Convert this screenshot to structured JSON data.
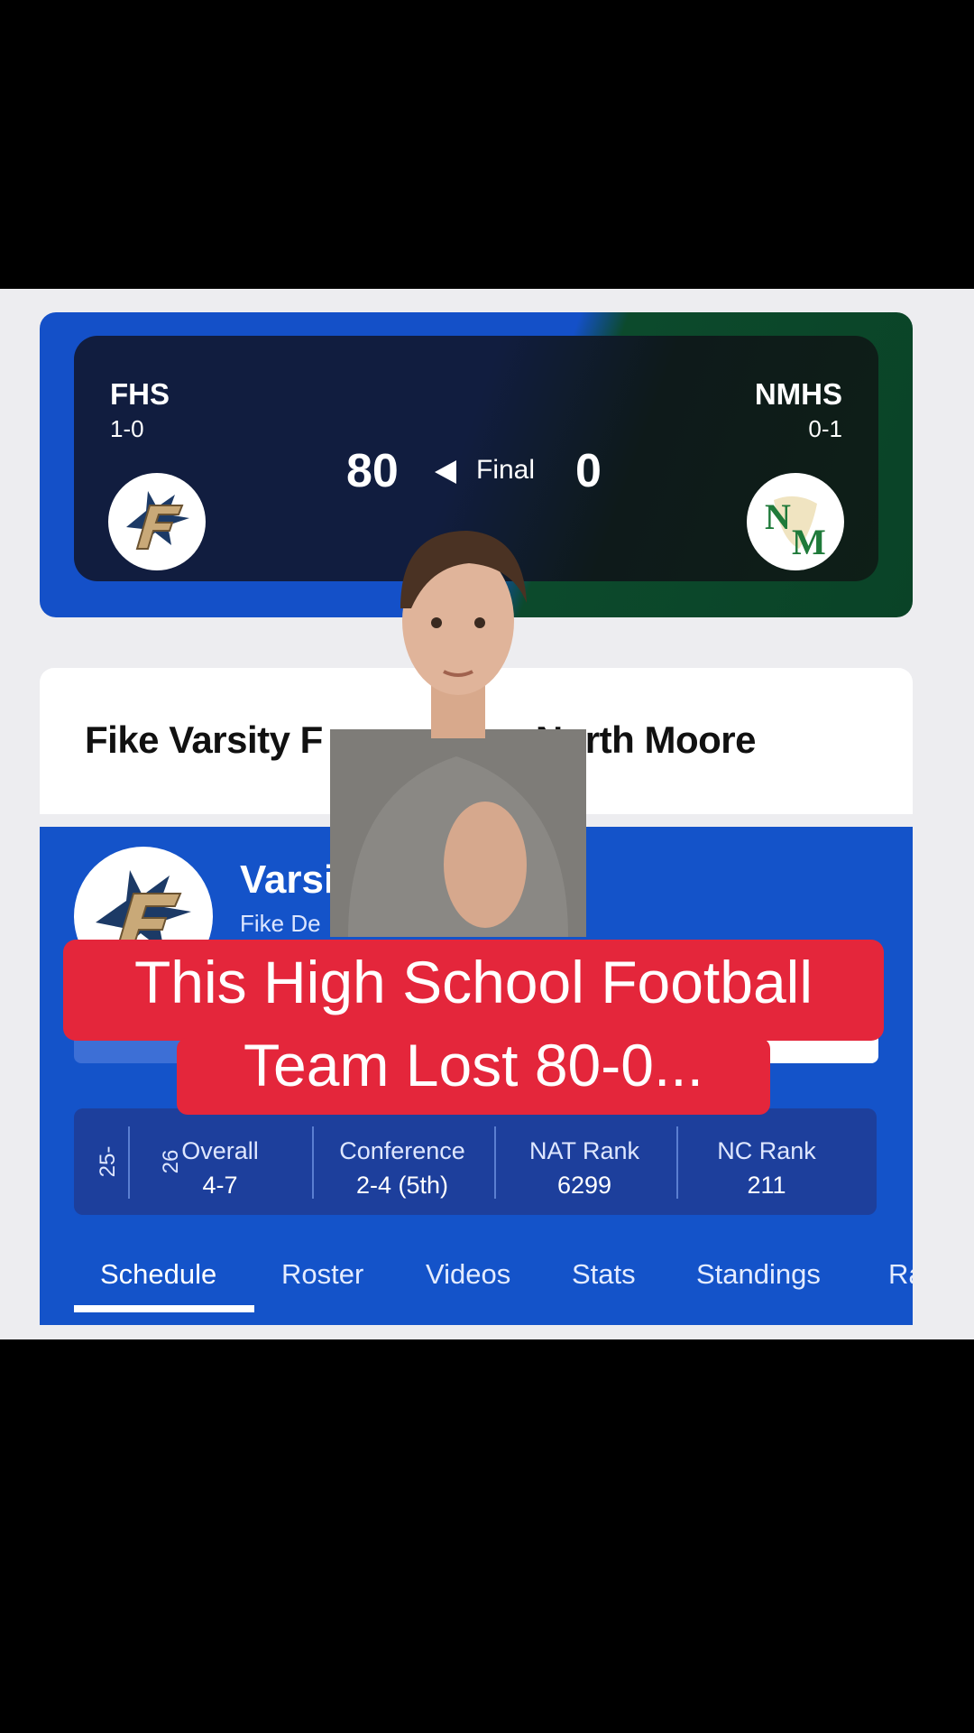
{
  "scoreboard": {
    "home": {
      "abbr": "FHS",
      "record": "1-0",
      "score": "80"
    },
    "away": {
      "abbr": "NMHS",
      "record": "0-1",
      "score": "0"
    },
    "status": "Final"
  },
  "game_title": {
    "left": "Fike Varsity F",
    "right": "North Moore"
  },
  "team": {
    "name": "Varsi",
    "subtitle": "Fike De",
    "season": "25-26",
    "stats": [
      {
        "label": "Overall",
        "value": "4-7"
      },
      {
        "label": "Conference",
        "value": "2-4 (5th)"
      },
      {
        "label": "NAT Rank",
        "value": "6299"
      },
      {
        "label": "NC Rank",
        "value": "211"
      }
    ],
    "tabs": [
      "Schedule",
      "Roster",
      "Videos",
      "Stats",
      "Standings",
      "Ra"
    ]
  },
  "caption": {
    "line1": "This High School Football",
    "line2": "Team Lost 80-0..."
  },
  "colors": {
    "accent_blue": "#1453c9",
    "away_green": "#0a4327",
    "caption_red": "#e4263b"
  },
  "icons": [
    "fike-falcons-logo",
    "north-moore-logo",
    "play-left-triangle-icon"
  ]
}
